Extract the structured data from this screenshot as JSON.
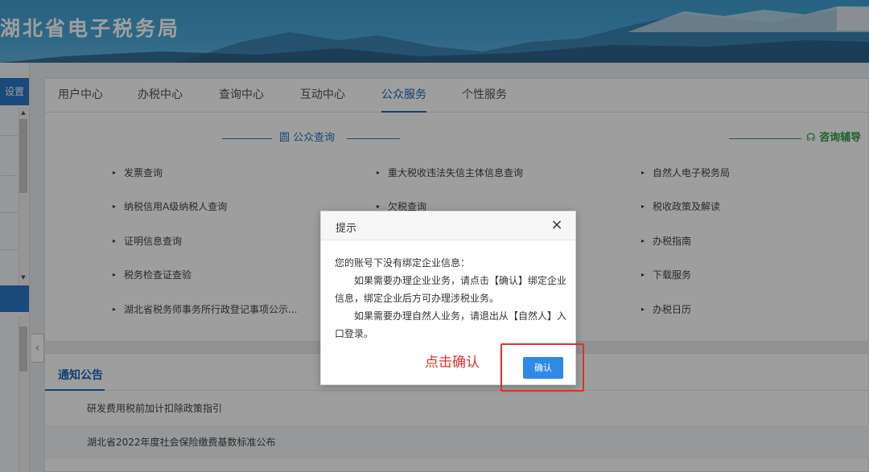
{
  "header": {
    "site_title": "湖北省电子税务局"
  },
  "sidebar": {
    "settings_label": "设置"
  },
  "tabs": [
    {
      "label": "用户中心"
    },
    {
      "label": "办税中心"
    },
    {
      "label": "查询中心"
    },
    {
      "label": "互动中心"
    },
    {
      "label": "公众服务",
      "active": true
    },
    {
      "label": "个性服务"
    }
  ],
  "public_query": {
    "title": "公众查询",
    "columns": [
      [
        "发票查询",
        "纳税信用A级纳税人查询",
        "证明信息查询",
        "税务检查证查验",
        "湖北省税务师事务所行政登记事项公示..."
      ],
      [
        "重大税收违法失信主体信息查询",
        "欠税查询"
      ],
      [
        "自然人电子税务局",
        "税收政策及解读",
        "办税指南",
        "下载服务",
        "办税日历"
      ]
    ]
  },
  "consult": {
    "title": "咨询辅导"
  },
  "notice": {
    "tab_label": "通知公告",
    "rows": [
      "研发费用税前加计扣除政策指引",
      "湖北省2022年度社会保险缴费基数标准公布"
    ]
  },
  "dialog": {
    "title": "提示",
    "close_symbol": "×",
    "line1": "您的账号下没有绑定企业信息：",
    "line2": "如果需要办理企业业务，请点击【确认】绑定企业信息，绑定企业后方可办理涉税业务。",
    "line3": "如果需要办理自然人业务，请退出从【自然人】入口登录。",
    "confirm_label": "确认",
    "annotation": "点击确认"
  },
  "colors": {
    "brand_blue": "#1f66b8",
    "confirm_blue": "#2e8ae6",
    "annotation_red": "#e0302a",
    "consult_green": "#2f9a48"
  }
}
